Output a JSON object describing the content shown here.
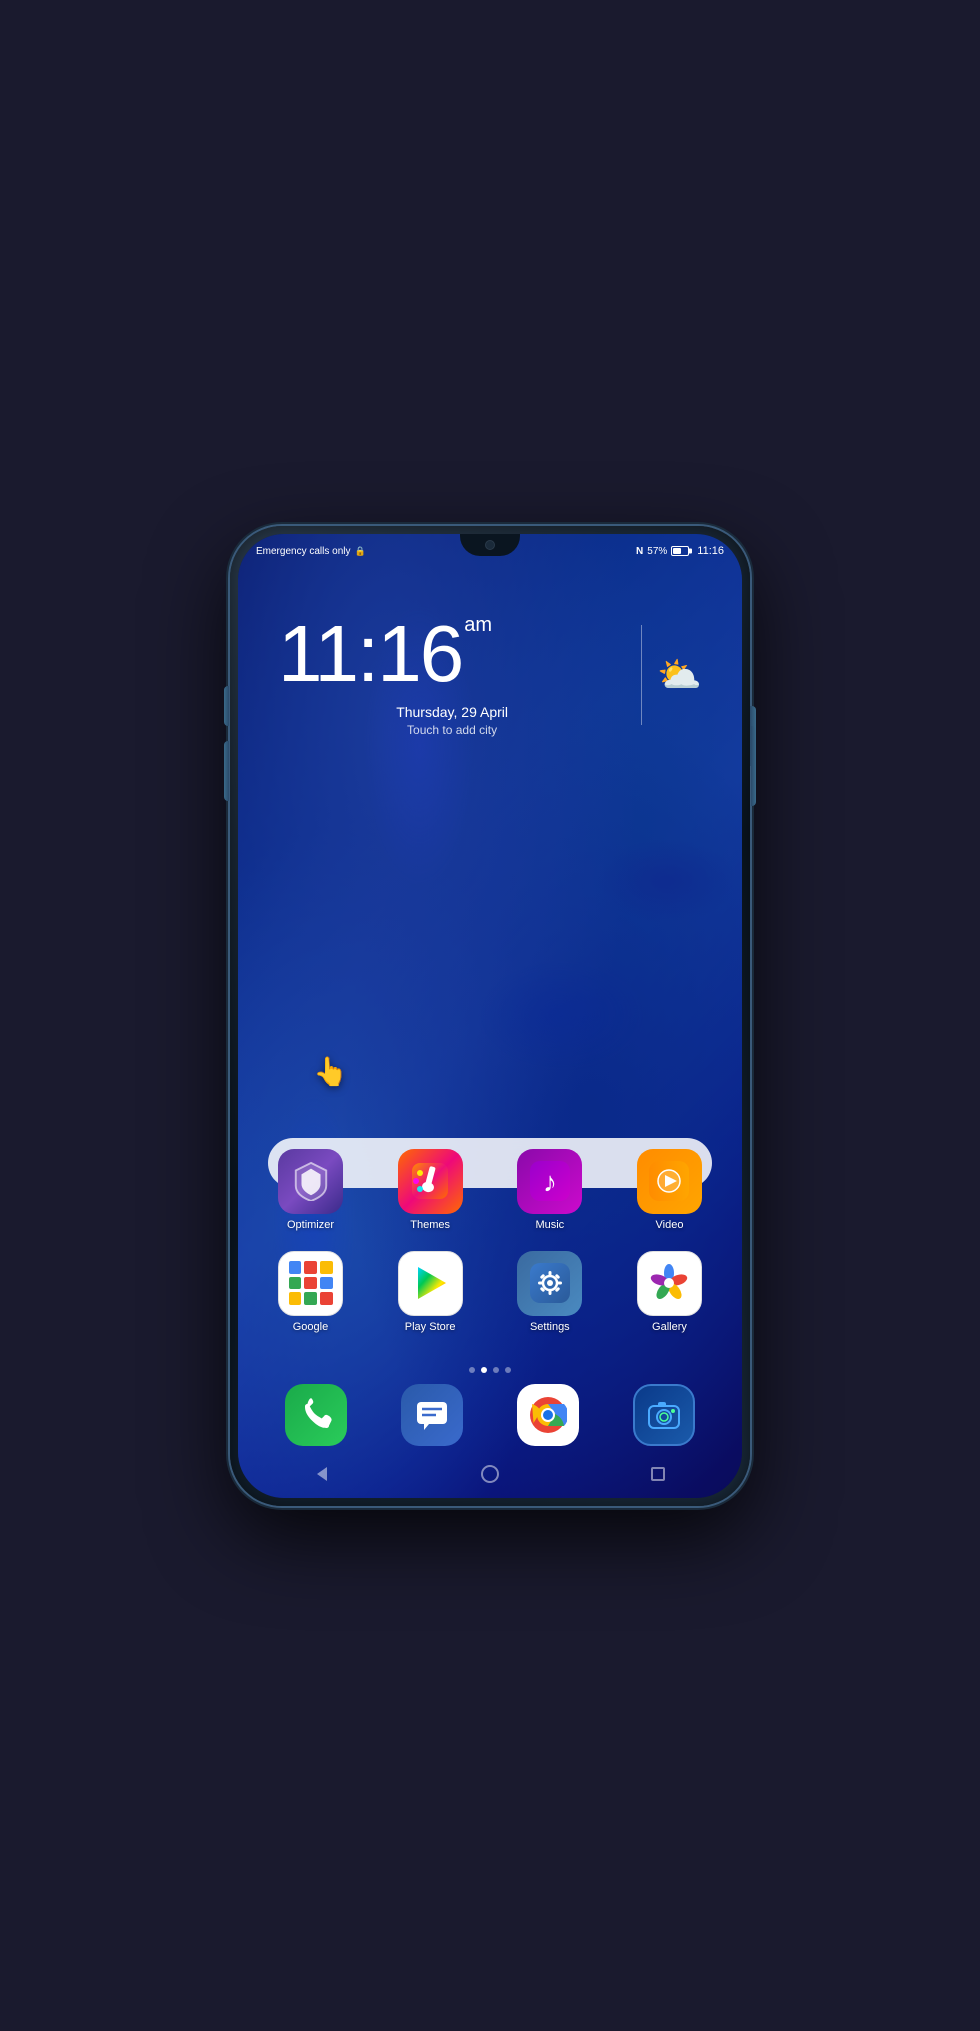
{
  "phone": {
    "status_bar": {
      "left_text": "Emergency calls only",
      "nfc_icon": "N",
      "battery_percent": "57%",
      "time": "11:16"
    },
    "clock_widget": {
      "time": "11:16",
      "am_pm": "am",
      "date": "Thursday, 29 April",
      "city_placeholder": "Touch to add city",
      "weather_icon": "⛅"
    },
    "search_bar": {
      "placeholder": ""
    },
    "apps_row1": [
      {
        "id": "optimizer",
        "label": "Optimizer",
        "icon_type": "optimizer"
      },
      {
        "id": "themes",
        "label": "Themes",
        "icon_type": "themes"
      },
      {
        "id": "music",
        "label": "Music",
        "icon_type": "music"
      },
      {
        "id": "video",
        "label": "Video",
        "icon_type": "video"
      }
    ],
    "apps_row2": [
      {
        "id": "google",
        "label": "Google",
        "icon_type": "google"
      },
      {
        "id": "playstore",
        "label": "Play Store",
        "icon_type": "playstore"
      },
      {
        "id": "settings",
        "label": "Settings",
        "icon_type": "settings"
      },
      {
        "id": "gallery",
        "label": "Gallery",
        "icon_type": "gallery"
      }
    ],
    "page_dots": [
      {
        "active": false
      },
      {
        "active": true
      },
      {
        "active": false
      },
      {
        "active": false
      }
    ],
    "dock": [
      {
        "id": "phone",
        "icon_type": "phone"
      },
      {
        "id": "messages",
        "icon_type": "messages"
      },
      {
        "id": "chrome",
        "icon_type": "chrome"
      },
      {
        "id": "camera",
        "icon_type": "camera"
      }
    ],
    "nav": {
      "back_label": "◁",
      "home_label": "○",
      "recents_label": "□"
    }
  }
}
